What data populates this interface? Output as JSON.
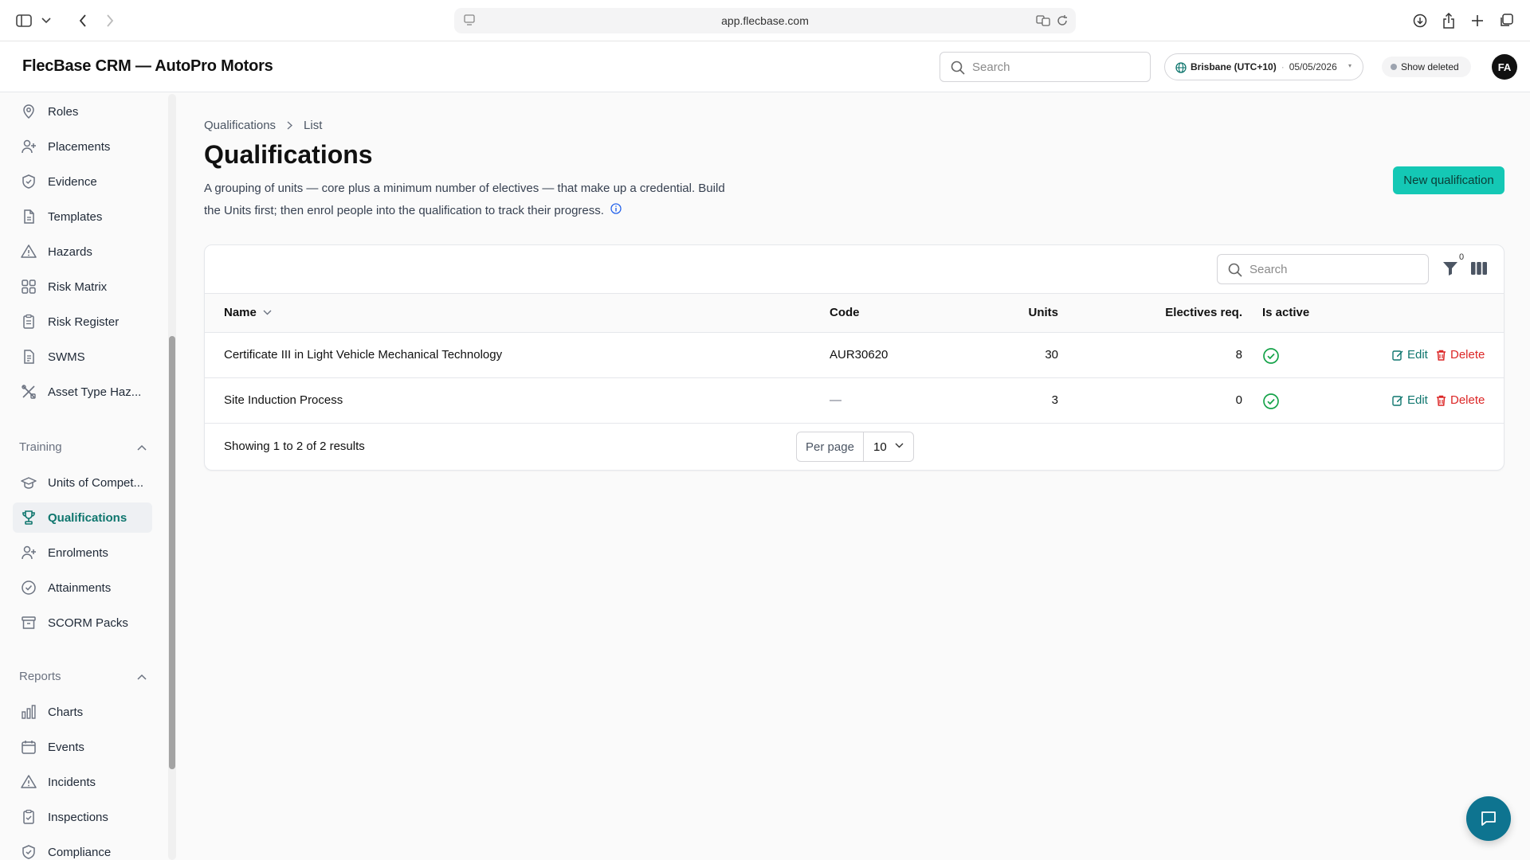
{
  "browser": {
    "url": "app.flecbase.com"
  },
  "header": {
    "brand": "FlecBase CRM — AutoPro Motors",
    "search_placeholder": "Search",
    "timezone_city": "Brisbane (UTC+10)",
    "timezone_date": "05/05/2026",
    "show_deleted": "Show deleted",
    "avatar_initials": "FA"
  },
  "sidebar": {
    "items_top": [
      {
        "label": "Roles",
        "icon": "location-pin-icon"
      },
      {
        "label": "Placements",
        "icon": "user-plus-icon"
      },
      {
        "label": "Evidence",
        "icon": "shield-check-icon"
      },
      {
        "label": "Templates",
        "icon": "file-icon"
      },
      {
        "label": "Hazards",
        "icon": "warning-triangle-icon"
      },
      {
        "label": "Risk Matrix",
        "icon": "grid-icon"
      },
      {
        "label": "Risk Register",
        "icon": "clipboard-icon"
      },
      {
        "label": "SWMS",
        "icon": "document-icon"
      },
      {
        "label": "Asset Type Haz...",
        "icon": "tools-icon"
      }
    ],
    "training_title": "Training",
    "items_training": [
      {
        "label": "Units of Compet...",
        "icon": "graduation-cap-icon"
      },
      {
        "label": "Qualifications",
        "icon": "trophy-icon"
      },
      {
        "label": "Enrolments",
        "icon": "user-plus-icon"
      },
      {
        "label": "Attainments",
        "icon": "badge-check-icon"
      },
      {
        "label": "SCORM Packs",
        "icon": "archive-icon"
      }
    ],
    "reports_title": "Reports",
    "items_reports": [
      {
        "label": "Charts",
        "icon": "bar-chart-icon"
      },
      {
        "label": "Events",
        "icon": "calendar-icon"
      },
      {
        "label": "Incidents",
        "icon": "warning-triangle-icon"
      },
      {
        "label": "Inspections",
        "icon": "clipboard-check-icon"
      },
      {
        "label": "Compliance",
        "icon": "shield-check-icon"
      }
    ]
  },
  "main": {
    "breadcrumb": [
      "Qualifications",
      "List"
    ],
    "title": "Qualifications",
    "description": "A grouping of units — core plus a minimum number of electives — that make up a credential. Build the Units first; then enrol people into the qualification to track their progress.",
    "new_button": "New qualification"
  },
  "table": {
    "search_placeholder": "Search",
    "filter_count": "0",
    "columns": {
      "name": "Name",
      "code": "Code",
      "units": "Units",
      "electives": "Electives req.",
      "active": "Is active"
    },
    "rows": [
      {
        "name": "Certificate III in Light Vehicle Mechanical Technology",
        "code": "AUR30620",
        "units": "30",
        "electives": "8",
        "active": true
      },
      {
        "name": "Site Induction Process",
        "code": "—",
        "units": "3",
        "electives": "0",
        "active": true
      }
    ],
    "edit_label": "Edit",
    "delete_label": "Delete",
    "footer_text": "Showing 1 to 2 of 2 results",
    "per_page_label": "Per page",
    "per_page_value": "10"
  },
  "colors": {
    "accent": "#14c8b5",
    "teal_text": "#0f766e",
    "danger": "#dc2626",
    "check": "#16a34a"
  }
}
